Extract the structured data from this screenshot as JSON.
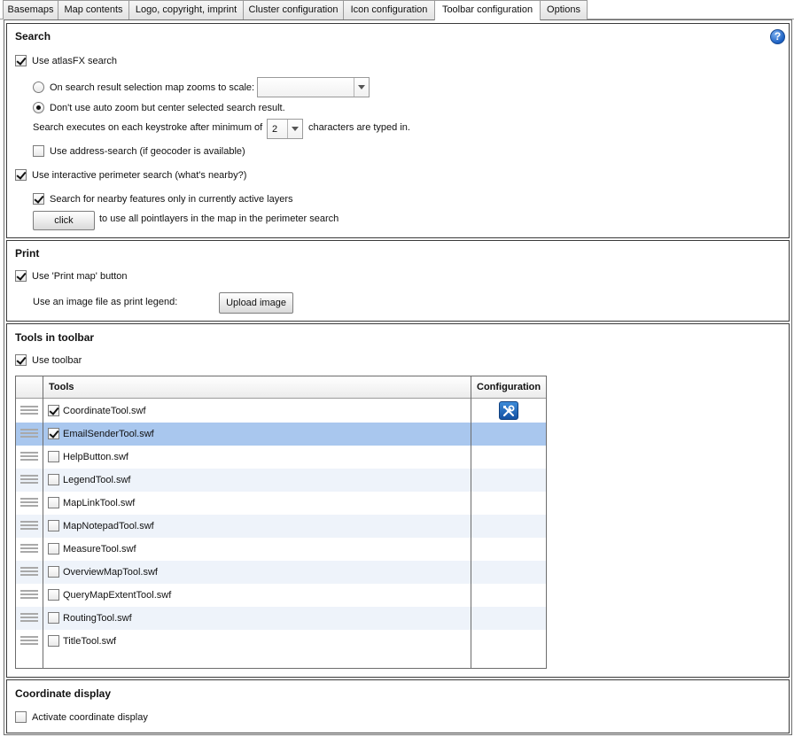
{
  "tabs": [
    {
      "label": "Basemaps"
    },
    {
      "label": "Map contents"
    },
    {
      "label": "Logo, copyright, imprint"
    },
    {
      "label": "Cluster configuration"
    },
    {
      "label": "Icon configuration"
    },
    {
      "label": "Toolbar configuration"
    },
    {
      "label": "Options"
    }
  ],
  "active_tab": "Toolbar configuration",
  "search": {
    "title": "Search",
    "use_atlasfx_label": "Use atlasFX search",
    "use_atlasfx_checked": true,
    "zoom_radio_label": "On search result selection map zooms to scale:",
    "zoom_radio_selected": false,
    "zoom_scale_value": "",
    "no_zoom_radio_label": "Don't use auto zoom but center selected search result.",
    "no_zoom_radio_selected": true,
    "keystroke_prefix": "Search executes on each keystroke after minimum of",
    "keystroke_value": "2",
    "keystroke_suffix": "characters are typed in.",
    "address_search_label": "Use address-search (if geocoder is available)",
    "address_search_checked": false,
    "perimeter_label": "Use interactive perimeter search (what's nearby?)",
    "perimeter_checked": true,
    "nearby_active_label": "Search for nearby features only in currently active layers",
    "nearby_active_checked": true,
    "click_button_label": "click",
    "click_suffix": "to use all pointlayers in the map in the perimeter search",
    "help_icon_glyph": "?"
  },
  "print": {
    "title": "Print",
    "use_print_label": "Use 'Print map' button",
    "use_print_checked": true,
    "legend_label": "Use an image file as print legend:",
    "upload_label": "Upload image"
  },
  "toolbar": {
    "title": "Tools in toolbar",
    "use_toolbar_label": "Use toolbar",
    "use_toolbar_checked": true,
    "columns": {
      "tools": "Tools",
      "configuration": "Configuration"
    },
    "tools": [
      {
        "name": "CoordinateTool.swf",
        "checked": true,
        "configurable": true,
        "selected": false
      },
      {
        "name": "EmailSenderTool.swf",
        "checked": true,
        "configurable": false,
        "selected": true
      },
      {
        "name": "HelpButton.swf",
        "checked": false,
        "configurable": false,
        "selected": false
      },
      {
        "name": "LegendTool.swf",
        "checked": false,
        "configurable": false,
        "selected": false
      },
      {
        "name": "MapLinkTool.swf",
        "checked": false,
        "configurable": false,
        "selected": false
      },
      {
        "name": "MapNotepadTool.swf",
        "checked": false,
        "configurable": false,
        "selected": false
      },
      {
        "name": "MeasureTool.swf",
        "checked": false,
        "configurable": false,
        "selected": false
      },
      {
        "name": "OverviewMapTool.swf",
        "checked": false,
        "configurable": false,
        "selected": false
      },
      {
        "name": "QueryMapExtentTool.swf",
        "checked": false,
        "configurable": false,
        "selected": false
      },
      {
        "name": "RoutingTool.swf",
        "checked": false,
        "configurable": false,
        "selected": false
      },
      {
        "name": "TitleTool.swf",
        "checked": false,
        "configurable": false,
        "selected": false
      }
    ]
  },
  "coordinate_display": {
    "title": "Coordinate display",
    "activate_label": "Activate coordinate display",
    "activate_checked": false
  },
  "colors": {
    "selected_row": "#a9c7ee",
    "alt_row": "#eef3fa",
    "accent_blue": "#1a5fc2"
  }
}
